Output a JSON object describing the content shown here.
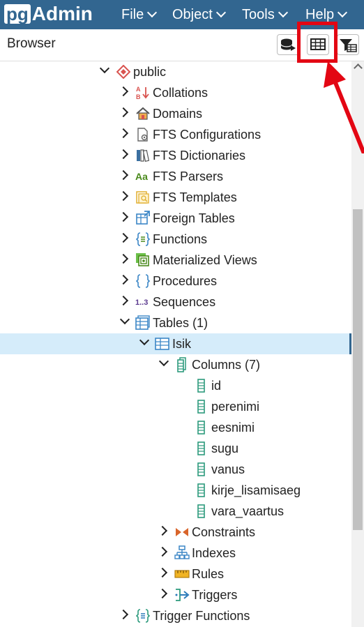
{
  "app": {
    "logo_pg": "pg",
    "logo_admin": "Admin"
  },
  "menu": [
    {
      "label": "File"
    },
    {
      "label": "Object"
    },
    {
      "label": "Tools"
    },
    {
      "label": "Help"
    }
  ],
  "browser": {
    "title": "Browser"
  },
  "toolbar": {
    "buttons": [
      {
        "icon": "query-tool-icon"
      },
      {
        "icon": "view-data-icon"
      },
      {
        "icon": "filtered-rows-icon"
      }
    ],
    "highlight_color": "#e30613"
  },
  "tree": [
    {
      "label": "public",
      "icon": "schema-icon",
      "state": "open"
    },
    {
      "label": "Collations",
      "icon": "collation-icon",
      "state": "closed"
    },
    {
      "label": "Domains",
      "icon": "domain-icon",
      "state": "closed"
    },
    {
      "label": "FTS Configurations",
      "icon": "fts-configuration-icon",
      "state": "closed"
    },
    {
      "label": "FTS Dictionaries",
      "icon": "fts-dictionary-icon",
      "state": "closed"
    },
    {
      "label": "FTS Parsers",
      "icon": "fts-parser-icon",
      "state": "closed"
    },
    {
      "label": "FTS Templates",
      "icon": "fts-template-icon",
      "state": "closed"
    },
    {
      "label": "Foreign Tables",
      "icon": "foreign-table-icon",
      "state": "closed"
    },
    {
      "label": "Functions",
      "icon": "function-icon",
      "state": "closed"
    },
    {
      "label": "Materialized Views",
      "icon": "materialized-view-icon",
      "state": "closed"
    },
    {
      "label": "Procedures",
      "icon": "procedure-icon",
      "state": "closed"
    },
    {
      "label": "Sequences",
      "icon": "sequence-icon",
      "state": "closed"
    },
    {
      "label": "Tables (1)",
      "icon": "tables-icon",
      "state": "open"
    },
    {
      "label": "Isik",
      "icon": "table-icon",
      "state": "open",
      "selected": true
    },
    {
      "label": "Columns (7)",
      "icon": "columns-icon",
      "state": "open"
    },
    {
      "label": "id",
      "icon": "column-icon",
      "state": "leaf"
    },
    {
      "label": "perenimi",
      "icon": "column-icon",
      "state": "leaf"
    },
    {
      "label": "eesnimi",
      "icon": "column-icon",
      "state": "leaf"
    },
    {
      "label": "sugu",
      "icon": "column-icon",
      "state": "leaf"
    },
    {
      "label": "vanus",
      "icon": "column-icon",
      "state": "leaf"
    },
    {
      "label": "kirje_lisamisaeg",
      "icon": "column-icon",
      "state": "leaf"
    },
    {
      "label": "vara_vaartus",
      "icon": "column-icon",
      "state": "leaf"
    },
    {
      "label": "Constraints",
      "icon": "constraints-icon",
      "state": "closed"
    },
    {
      "label": "Indexes",
      "icon": "indexes-icon",
      "state": "closed"
    },
    {
      "label": "Rules",
      "icon": "rules-icon",
      "state": "closed"
    },
    {
      "label": "Triggers",
      "icon": "triggers-icon",
      "state": "closed"
    },
    {
      "label": "Trigger Functions",
      "icon": "trigger-function-icon",
      "state": "closed"
    }
  ]
}
